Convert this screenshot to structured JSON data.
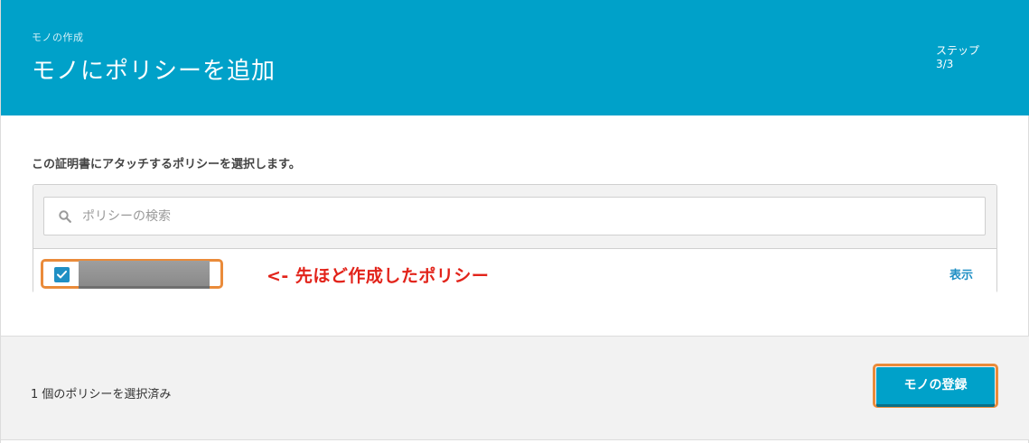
{
  "header": {
    "breadcrumb": "モノの作成",
    "title": "モノにポリシーを追加",
    "step_label": "ステップ",
    "step_value": "3/3"
  },
  "main": {
    "instruction": "この証明書にアタッチするポリシーを選択します。",
    "search": {
      "placeholder": "ポリシーの検索",
      "value": ""
    },
    "policy_row": {
      "checked": true,
      "annotation": "<- 先ほど作成したポリシー",
      "view_label": "表示"
    }
  },
  "footer": {
    "selected_count": "1 個のポリシーを選択済み",
    "register_label": "モノの登録"
  },
  "colors": {
    "header_bg": "#00a1c9",
    "link": "#1f8fc4",
    "annotation": "#e2231a",
    "highlight": "#ea8b3a"
  }
}
